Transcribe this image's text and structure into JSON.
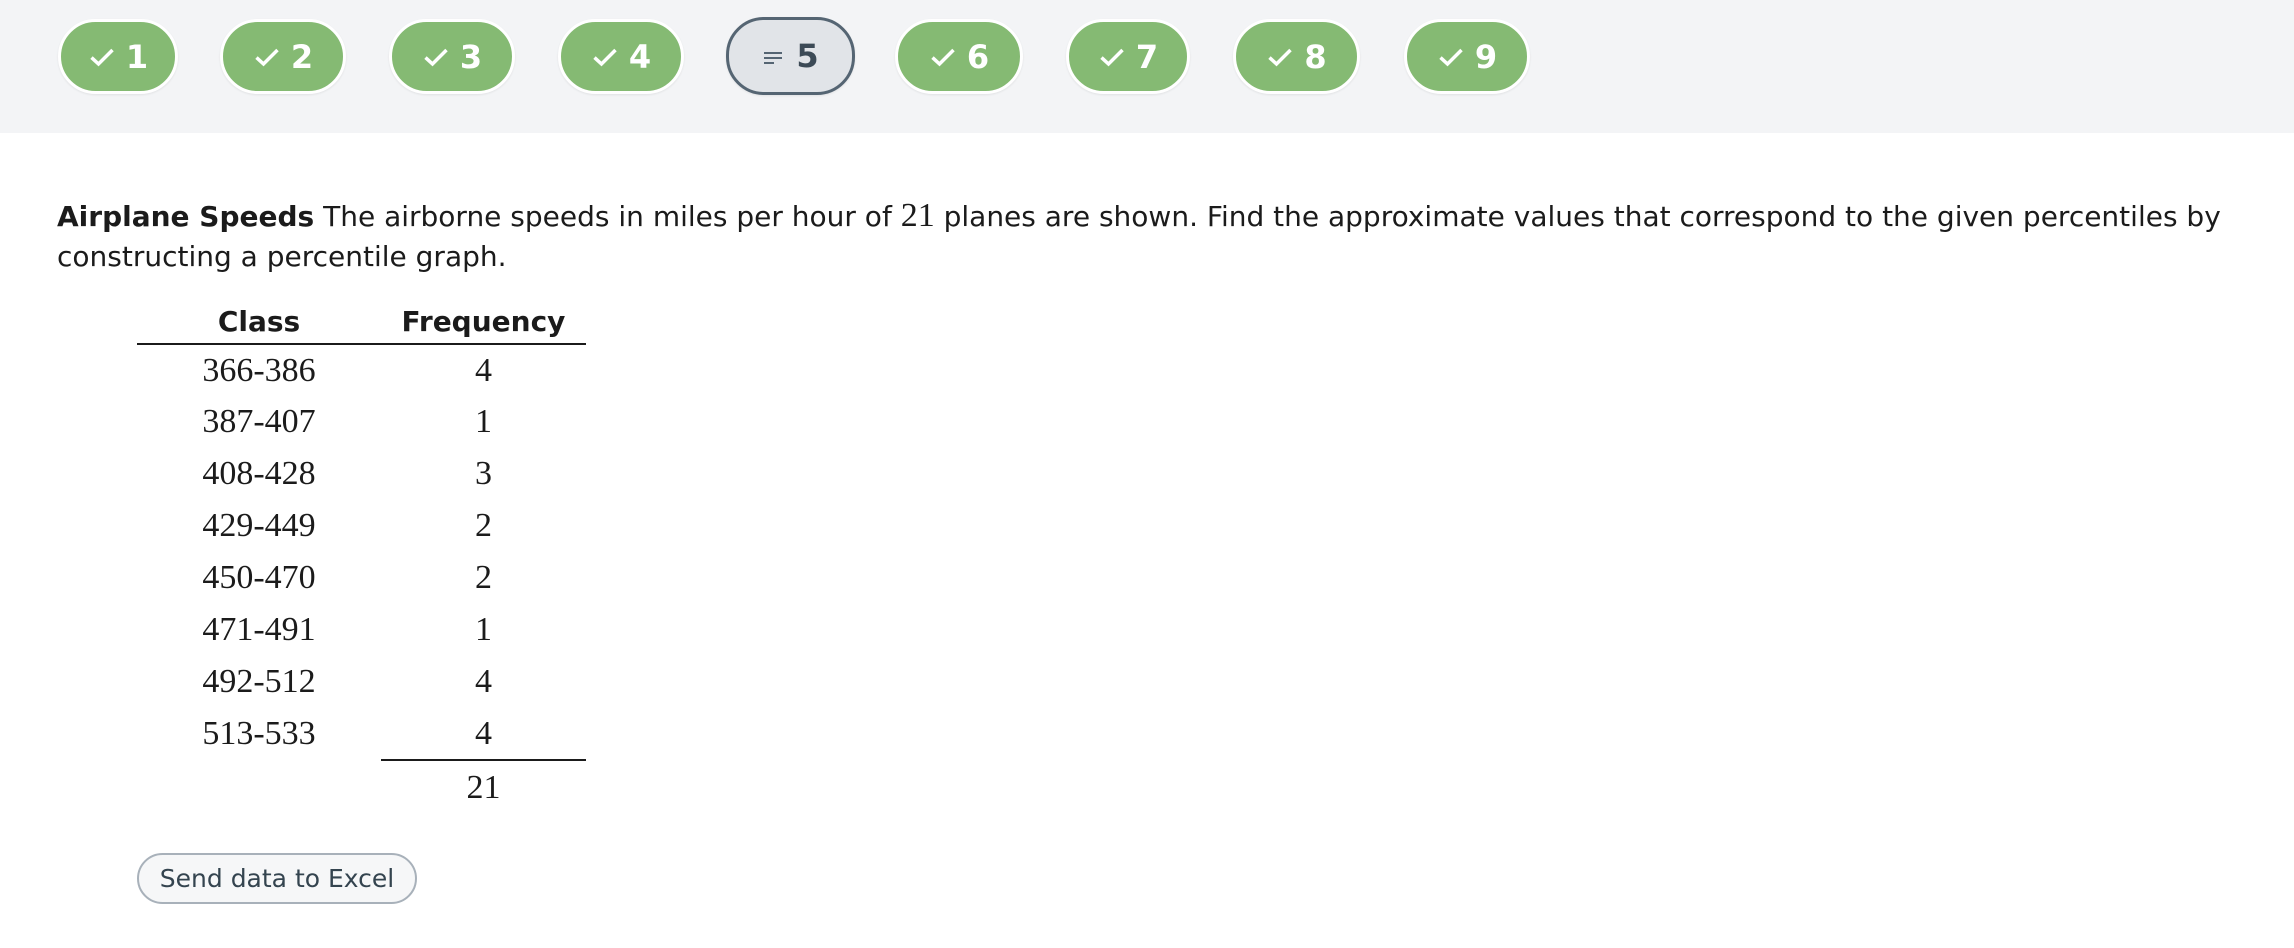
{
  "steps": [
    {
      "label": "1",
      "state": "complete",
      "icon": "check-icon"
    },
    {
      "label": "2",
      "state": "complete",
      "icon": "check-icon"
    },
    {
      "label": "3",
      "state": "complete",
      "icon": "check-icon"
    },
    {
      "label": "4",
      "state": "complete",
      "icon": "check-icon"
    },
    {
      "label": "5",
      "state": "current",
      "icon": "list-lines-icon"
    },
    {
      "label": "6",
      "state": "complete",
      "icon": "check-icon"
    },
    {
      "label": "7",
      "state": "complete",
      "icon": "check-icon"
    },
    {
      "label": "8",
      "state": "complete",
      "icon": "check-icon"
    },
    {
      "label": "9",
      "state": "complete",
      "icon": "check-icon"
    }
  ],
  "problem": {
    "title": "Airplane Speeds",
    "text_before": " The airborne speeds in miles per hour of ",
    "count": "21",
    "text_after": " planes are shown. Find the approximate values that correspond to the given percentiles by constructing a percentile graph."
  },
  "table": {
    "headers": [
      "Class",
      "Frequency"
    ],
    "rows": [
      [
        "366-386",
        "4"
      ],
      [
        "387-407",
        "1"
      ],
      [
        "408-428",
        "3"
      ],
      [
        "429-449",
        "2"
      ],
      [
        "450-470",
        "2"
      ],
      [
        "471-491",
        "1"
      ],
      [
        "492-512",
        "4"
      ],
      [
        "513-533",
        "4"
      ]
    ],
    "total": "21"
  },
  "excel_button": "Send data to Excel",
  "colors": {
    "complete_step": "#85ba73",
    "current_step_bg": "#e1e4e8",
    "current_step_border": "#556573",
    "topbar_bg": "#f3f4f6"
  }
}
